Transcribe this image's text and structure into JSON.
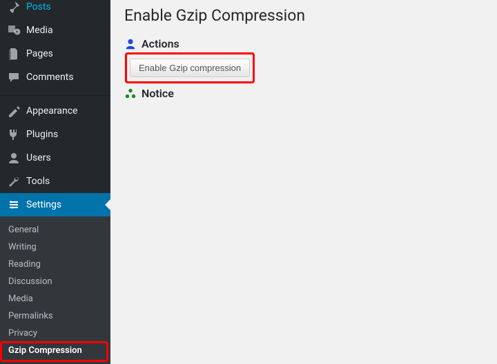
{
  "sidebar": {
    "items": [
      {
        "label": "Posts"
      },
      {
        "label": "Media"
      },
      {
        "label": "Pages"
      },
      {
        "label": "Comments"
      },
      {
        "label": "Appearance"
      },
      {
        "label": "Plugins"
      },
      {
        "label": "Users"
      },
      {
        "label": "Tools"
      },
      {
        "label": "Settings"
      }
    ],
    "submenu": [
      {
        "label": "General"
      },
      {
        "label": "Writing"
      },
      {
        "label": "Reading"
      },
      {
        "label": "Discussion"
      },
      {
        "label": "Media"
      },
      {
        "label": "Permalinks"
      },
      {
        "label": "Privacy"
      },
      {
        "label": "Gzip Compression"
      }
    ]
  },
  "page": {
    "title": "Enable Gzip Compression",
    "section_actions": "Actions",
    "section_notice": "Notice",
    "button_label": "Enable Gzip compression"
  }
}
